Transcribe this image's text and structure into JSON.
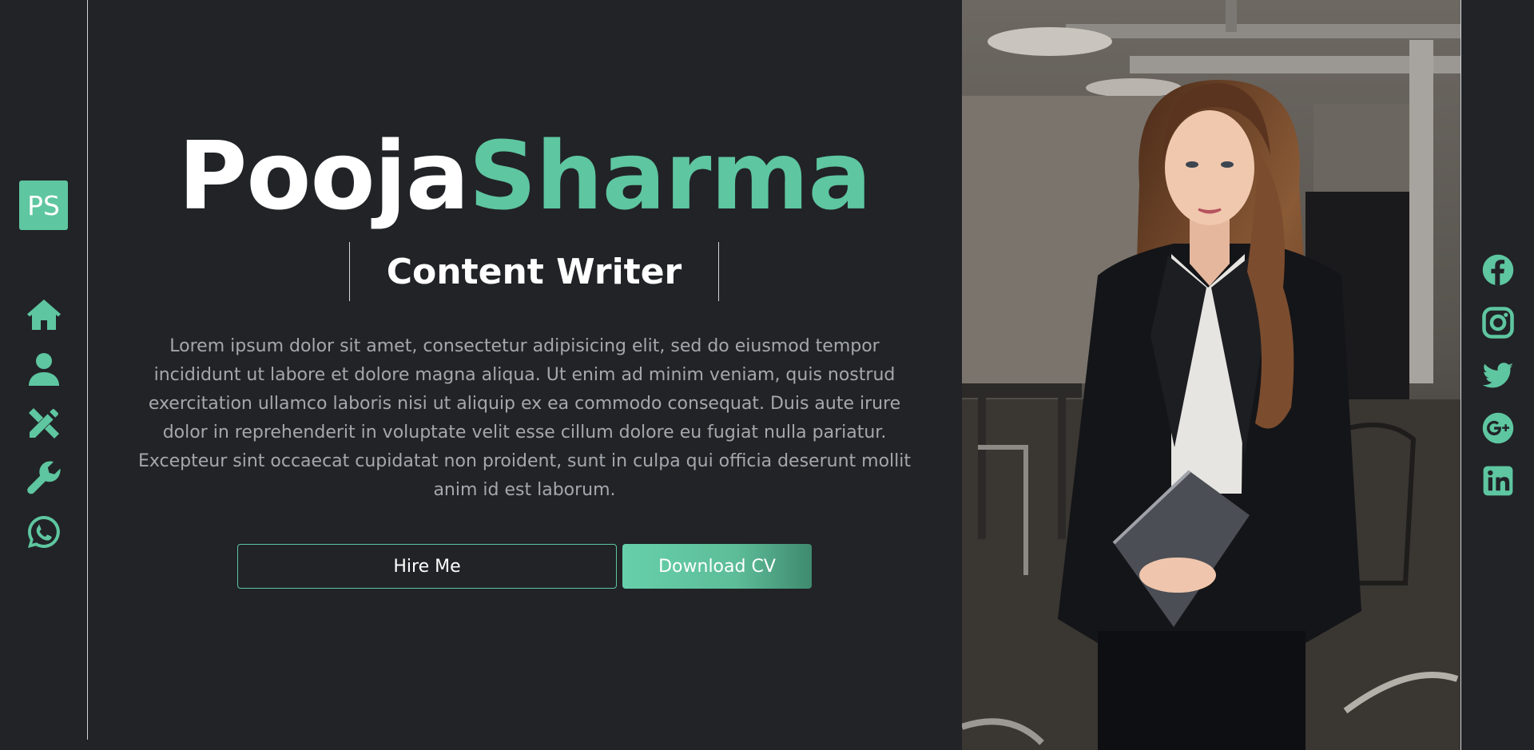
{
  "brand": {
    "logo_text": "PS",
    "accent_color": "#5ec6a0",
    "background_color": "#212327"
  },
  "sidebar": {
    "items": [
      {
        "icon": "home-icon",
        "label": "Home"
      },
      {
        "icon": "user-icon",
        "label": "About"
      },
      {
        "icon": "design-tools-icon",
        "label": "Services"
      },
      {
        "icon": "wrench-icon",
        "label": "Skills"
      },
      {
        "icon": "whatsapp-icon",
        "label": "Contact"
      }
    ]
  },
  "hero": {
    "first_name": "Pooja",
    "last_name": "Sharma",
    "role": "Content Writer",
    "bio": "Lorem ipsum dolor sit amet, consectetur adipisicing elit, sed do eiusmod tempor incididunt ut labore et dolore magna aliqua. Ut enim ad minim veniam, quis nostrud exercitation ullamco laboris nisi ut aliquip ex ea commodo consequat. Duis aute irure dolor in reprehenderit in voluptate velit esse cillum dolore eu fugiat nulla pariatur. Excepteur sint occaecat cupidatat non proident, sunt in culpa qui officia deserunt mollit anim id est laborum.",
    "hire_label": "Hire Me",
    "download_label": "Download CV"
  },
  "social": {
    "items": [
      {
        "icon": "facebook-icon"
      },
      {
        "icon": "instagram-icon"
      },
      {
        "icon": "twitter-icon"
      },
      {
        "icon": "google-plus-icon"
      },
      {
        "icon": "linkedin-icon"
      }
    ]
  }
}
